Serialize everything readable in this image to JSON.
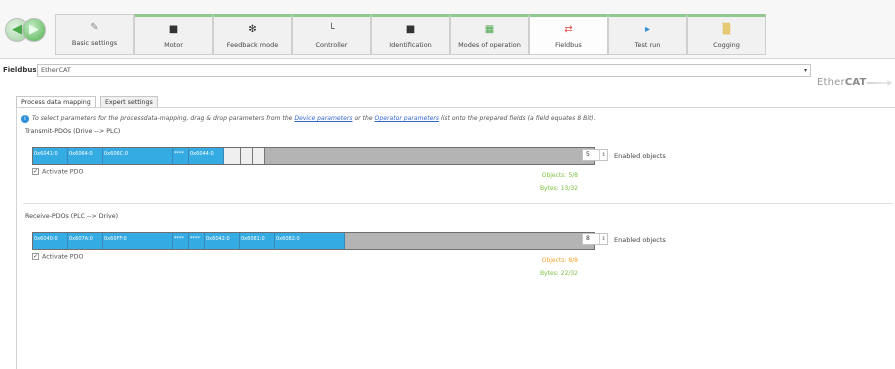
{
  "toolbar": {
    "nav_back_glyph": "◀",
    "nav_forward_glyph": "▶",
    "tabs": [
      {
        "label": "Basic settings",
        "icon": "wrench-icon",
        "glyph": "✎",
        "color": "#8a8a8a"
      },
      {
        "label": "Motor",
        "icon": "motor-icon",
        "glyph": "■",
        "color": "#333333"
      },
      {
        "label": "Feedback mode",
        "icon": "feedback-icon",
        "glyph": "❇",
        "color": "#333333"
      },
      {
        "label": "Controller",
        "icon": "controller-icon",
        "glyph": "└",
        "color": "#555555"
      },
      {
        "label": "Identification",
        "icon": "identification-icon",
        "glyph": "■",
        "color": "#333333"
      },
      {
        "label": "Modes of operation",
        "icon": "modes-icon",
        "glyph": "▦",
        "color": "#4aa84a"
      },
      {
        "label": "Fieldbus",
        "icon": "fieldbus-icon",
        "glyph": "⇄",
        "color": "#d9534f"
      },
      {
        "label": "Test run",
        "icon": "play-icon",
        "glyph": "▸",
        "color": "#2e8fd8"
      },
      {
        "label": "Cogging",
        "icon": "cogging-icon",
        "glyph": "▒",
        "color": "#d9a400"
      }
    ]
  },
  "fieldbus": {
    "label": "Fieldbus:",
    "value": "EtherCAT"
  },
  "logo": {
    "pre": "Ether",
    "bold": "CAT"
  },
  "subtabs": {
    "process": "Process data mapping",
    "expert": "Expert settings"
  },
  "info": {
    "pre": "To select parameters for the processdata-mapping, drag & drop parameters from the",
    "link1": "Device parameters",
    "mid": "or the",
    "link2": "Operator parameters",
    "post": "list onto the prepared fields (a field equates 8 Bit)."
  },
  "transmit": {
    "title": "Transmit-PDOs (Drive --> PLC)",
    "segments": [
      "0x6041:0",
      "0x6064:0",
      "0x606C:0",
      "****",
      "0x6044:0"
    ],
    "activate": "Activate PDO",
    "enabled_count": "5",
    "enabled_label": "Enabled objects",
    "objects": "Objects: 5/8",
    "bytes": "Bytes: 13/32",
    "status_color": "#7cc142",
    "fill_fraction": 0.41
  },
  "receive": {
    "title": "Receive-PDOs (PLC --> Drive)",
    "segments": [
      "0x6040:0",
      "0x607A:0",
      "0x60FF:0",
      "****",
      "****",
      "0x6042:0",
      "0x6081:0",
      "0x6082:0"
    ],
    "activate": "Activate PDO",
    "enabled_count": "8",
    "enabled_label": "Enabled objects",
    "objects": "Objects: 8/8",
    "bytes": "Bytes: 22/32",
    "objects_color": "#f0a030",
    "bytes_color": "#7cc142",
    "fill_fraction": 0.69
  }
}
